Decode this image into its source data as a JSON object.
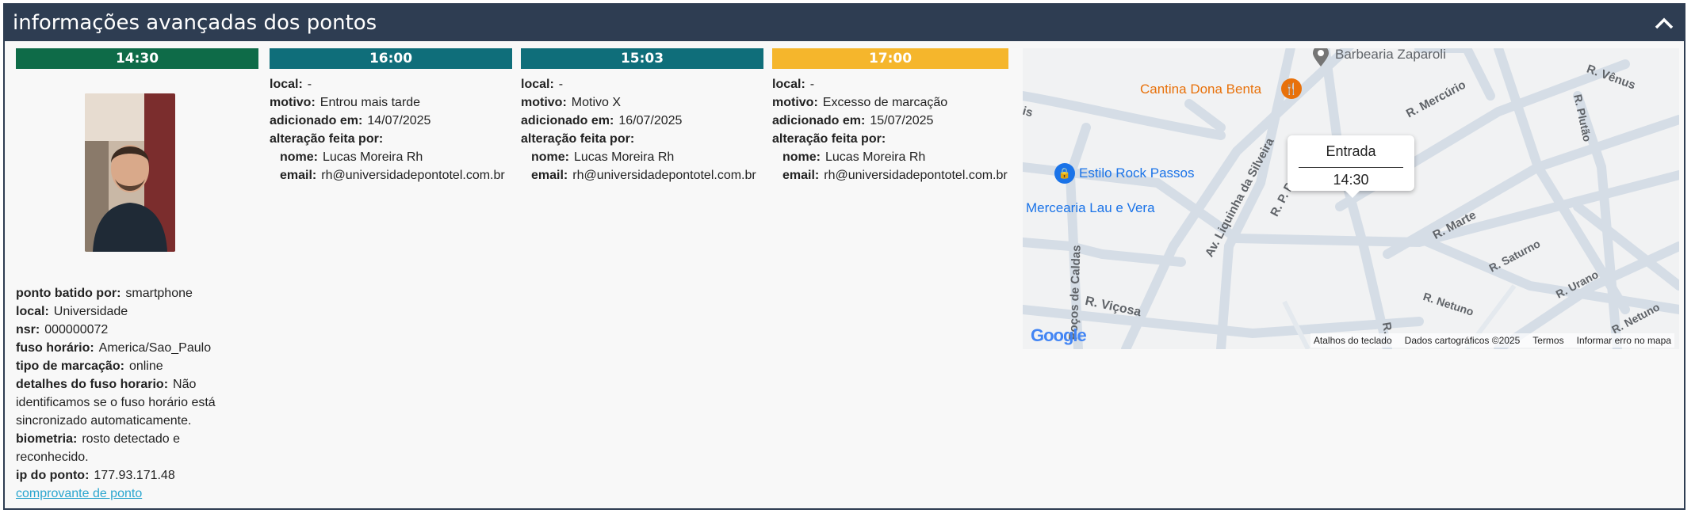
{
  "header": {
    "title": "informações avançadas dos pontos"
  },
  "colors": {
    "header_bg": "#2e3d52",
    "bar_first": "#0e6b48",
    "bar_teal": "#0f6e7a",
    "bar_orange": "#f5b62c",
    "link": "#2ba6cf"
  },
  "first": {
    "time": "14:30",
    "labels": {
      "ponto_batido_por": "ponto batido por:",
      "local": "local:",
      "nsr": "nsr:",
      "fuso_horario": "fuso horário:",
      "tipo_marcacao": "tipo de marcação:",
      "detalhes_fuso": "detalhes do fuso horario:",
      "biometria": "biometria:",
      "ip": "ip do ponto:"
    },
    "ponto_batido_por": "smartphone",
    "local": "Universidade",
    "nsr": "000000072",
    "fuso_horario": "America/Sao_Paulo",
    "tipo_marcacao": "online",
    "detalhes_fuso": "Não identificamos se o fuso horário está sincronizado automaticamente.",
    "biometria": "rosto detectado e reconhecido.",
    "ip": "177.93.171.48",
    "link": "comprovante de ponto"
  },
  "labels": {
    "local": "local:",
    "motivo": "motivo:",
    "adicionado_em": "adicionado em:",
    "alteracao": "alteração feita por:",
    "nome": "nome:",
    "email": "email:"
  },
  "columns": [
    {
      "time": "16:00",
      "local": "-",
      "motivo": "Entrou mais tarde",
      "adicionado_em": "14/07/2025",
      "nome": "Lucas Moreira Rh",
      "email": "rh@universidadepontotel.com.br"
    },
    {
      "time": "15:03",
      "local": "-",
      "motivo": "Motivo X",
      "adicionado_em": "16/07/2025",
      "nome": "Lucas Moreira Rh",
      "email": "rh@universidadepontotel.com.br"
    },
    {
      "time": "17:00",
      "local": "-",
      "motivo": "Excesso de marcação",
      "adicionado_em": "15/07/2025",
      "nome": "Lucas Moreira Rh",
      "email": "rh@universidadepontotel.com.br"
    }
  ],
  "map": {
    "tooltip_title": "Entrada",
    "tooltip_time": "14:30",
    "places": {
      "barbearia": "Barbearia Zaparoli",
      "cantina": "Cantina Dona Benta",
      "estilo": "Estilo Rock Passos",
      "mercearia": "Mercearia Lau e Vera"
    },
    "streets": {
      "venus": "R. Vênus",
      "mercurio": "R. Mercúrio",
      "plutao": "R. Plutão",
      "liquinha": "Av. Liquinha da Silveira",
      "marte": "R. Marte",
      "saturno": "R. Saturno",
      "urano": "R. Urano",
      "netuno1": "R. Netuno",
      "netuno2": "R. Netuno",
      "vicosa": "R. Viçosa",
      "pocos": "Poços de Caldas",
      "ped": "R. P. Ped",
      "nus": "nus",
      "is": "is",
      "rdot": "R."
    },
    "google": "Google",
    "footer": {
      "atalhos": "Atalhos do teclado",
      "dados": "Dados cartográficos ©2025",
      "termos": "Termos",
      "erro": "Informar erro no mapa"
    }
  }
}
